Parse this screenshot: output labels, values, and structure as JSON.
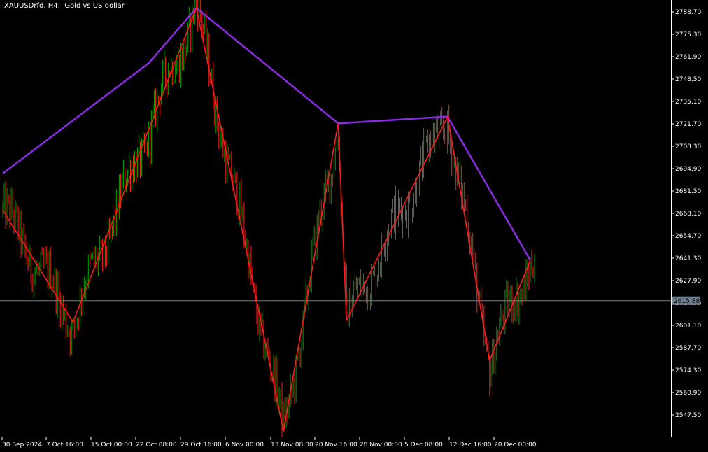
{
  "header": {
    "symbol": "XAUUSDrfd, H4:",
    "description": "Gold vs US dollar"
  },
  "colors": {
    "background": "#000000",
    "axis": "#ffffff",
    "bull_candle": "#00a000",
    "bear_candle": "#ff2020",
    "zigzag_fast": "#ff1a1a",
    "zigzag_slow": "#8a2be2",
    "price_line": "#708090",
    "price_label_bg": "#708090"
  },
  "chart_data": {
    "type": "candlestick",
    "symbol": "XAUUSDrfd",
    "timeframe": "H4",
    "ylim": [
      2535.0,
      2795.0
    ],
    "y_ticks": [
      "2788.70",
      "2775.30",
      "2761.90",
      "2748.50",
      "2735.10",
      "2721.70",
      "2708.30",
      "2694.90",
      "2681.50",
      "2668.10",
      "2654.70",
      "2641.30",
      "2627.90",
      "2614.50",
      "2601.10",
      "2587.70",
      "2574.30",
      "2560.90",
      "2547.50"
    ],
    "x_ticks": [
      "30 Sep 2024",
      "7 Oct 16:00",
      "15 Oct 00:00",
      "22 Oct 08:00",
      "29 Oct 16:00",
      "6 Nov 00:00",
      "13 Nov 08:00",
      "20 Nov 16:00",
      "28 Nov 00:00",
      "5 Dec 08:00",
      "12 Dec 16:00",
      "20 Dec 00:00"
    ],
    "current_price": "2615.88",
    "bar_count": 380,
    "zigzag_fast": [
      {
        "bar": 0,
        "price": 2670.0
      },
      {
        "bar": 50,
        "price": 2603.0
      },
      {
        "bar": 138,
        "price": 2791.0
      },
      {
        "bar": 200,
        "price": 2538.0
      },
      {
        "bar": 239,
        "price": 2722.0
      },
      {
        "bar": 245,
        "price": 2604.0
      },
      {
        "bar": 317,
        "price": 2726.0
      },
      {
        "bar": 347,
        "price": 2580.0
      },
      {
        "bar": 376,
        "price": 2640.0
      }
    ],
    "zigzag_slow": [
      {
        "bar": 0,
        "price": 2692.0
      },
      {
        "bar": 104,
        "price": 2758.0
      },
      {
        "bar": 138,
        "price": 2791.0
      },
      {
        "bar": 239,
        "price": 2722.0
      },
      {
        "bar": 317,
        "price": 2726.0
      },
      {
        "bar": 376,
        "price": 2640.0
      }
    ]
  }
}
